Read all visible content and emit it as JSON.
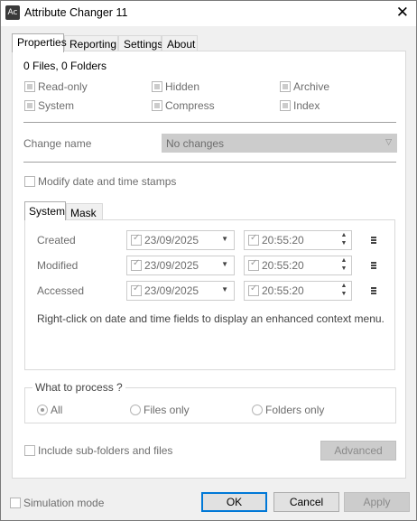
{
  "window": {
    "title": "Attribute Changer 11",
    "app_icon_text": "Ac",
    "close_glyph": "✕"
  },
  "tabs": [
    {
      "label": "Properties",
      "active": true
    },
    {
      "label": "Reporting",
      "active": false
    },
    {
      "label": "Settings",
      "active": false
    },
    {
      "label": "About",
      "active": false
    }
  ],
  "properties": {
    "summary": "0 Files, 0 Folders",
    "attributes": {
      "read_only": "Read-only",
      "hidden": "Hidden",
      "archive": "Archive",
      "system": "System",
      "compress": "Compress",
      "index": "Index"
    },
    "change_name_label": "Change name",
    "change_name_value": "No changes",
    "modify_dates_label": "Modify date and time stamps",
    "inner_tabs": [
      {
        "label": "System",
        "active": true
      },
      {
        "label": "Mask",
        "active": false
      }
    ],
    "dates": [
      {
        "label": "Created",
        "date": "23/09/2025",
        "time": "20:55:20"
      },
      {
        "label": "Modified",
        "date": "23/09/2025",
        "time": "20:55:20"
      },
      {
        "label": "Accessed",
        "date": "23/09/2025",
        "time": "20:55:20"
      }
    ],
    "hint": "Right-click on date and time fields to display an enhanced context menu.",
    "process": {
      "title": "What to process ?",
      "options": [
        "All",
        "Files only",
        "Folders only"
      ],
      "selected": "All"
    },
    "include_subfolders_label": "Include sub-folders and files",
    "advanced_label": "Advanced"
  },
  "footer": {
    "simulation_label": "Simulation mode",
    "ok_label": "OK",
    "cancel_label": "Cancel",
    "apply_label": "Apply"
  },
  "colors": {
    "default_button_border": "#0078d7",
    "disabled_fill": "#cccccc",
    "window_bg": "#f0f0f0"
  }
}
